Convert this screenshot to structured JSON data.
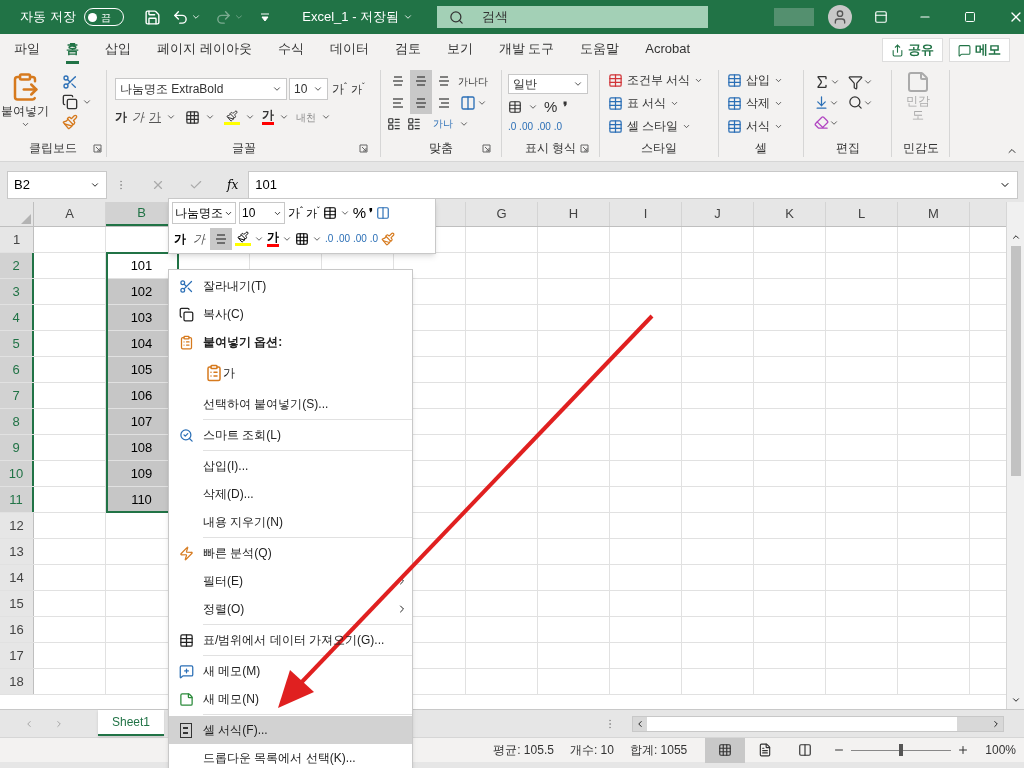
{
  "title_bar": {
    "autosave_label": "자동 저장",
    "autosave_state": "끔",
    "autosave_on": false,
    "file_title": "Excel_1 - 저장됨",
    "search_placeholder": "검색"
  },
  "ribbon_tabs": [
    {
      "label": "파일",
      "selected": false
    },
    {
      "label": "홈",
      "selected": true
    },
    {
      "label": "삽입",
      "selected": false
    },
    {
      "label": "페이지 레이아웃",
      "selected": false
    },
    {
      "label": "수식",
      "selected": false
    },
    {
      "label": "데이터",
      "selected": false
    },
    {
      "label": "검토",
      "selected": false
    },
    {
      "label": "보기",
      "selected": false
    },
    {
      "label": "개발 도구",
      "selected": false
    },
    {
      "label": "도움말",
      "selected": false
    },
    {
      "label": "Acrobat",
      "selected": false
    }
  ],
  "share_button": "공유",
  "comments_button": "메모",
  "ribbon": {
    "clipboard": {
      "paste": "붙여넣기",
      "label": "클립보드"
    },
    "font": {
      "name": "나눔명조 ExtraBold",
      "size": "10",
      "grow": "가$^{ˆ}$",
      "shrink": "가$^{ˇ}$",
      "bold": "가",
      "italic": "가",
      "underline": "가",
      "font_color": "가",
      "phonetic": "내천",
      "label": "글꼴"
    },
    "alignment": {
      "vertical": [
        {
          "selected": false
        },
        {
          "selected": true
        },
        {
          "selected": false
        }
      ],
      "horizontal": [
        {
          "selected": false
        },
        {
          "selected": true
        },
        {
          "selected": false
        }
      ],
      "wrap": "가나다",
      "orientation": "가나",
      "label": "맞춤"
    },
    "number": {
      "format": "일반",
      "percent": "%",
      "comma": "❜",
      "inc_decimal": ".0 .00",
      "dec_decimal": ".00 .0",
      "label": "표시 형식"
    },
    "styles": {
      "items": [
        "조건부 서식",
        "표 서식",
        "셀 스타일"
      ],
      "label": "스타일"
    },
    "cells": {
      "items": [
        "삽입",
        "삭제",
        "서식"
      ],
      "label": "셀"
    },
    "editing": {
      "label": "편집"
    },
    "sensitivity": {
      "button": "민감도",
      "label": "민감도",
      "disabled": true
    }
  },
  "formula_bar": {
    "name_box": "B2",
    "fx": "fx",
    "value": "101"
  },
  "columns_left": [
    {
      "label": "A",
      "selected": false
    },
    {
      "label": "B",
      "selected": true
    }
  ],
  "columns_right": [
    {
      "label": "G",
      "selected": false
    },
    {
      "label": "H",
      "selected": false
    },
    {
      "label": "I",
      "selected": false
    },
    {
      "label": "J",
      "selected": false
    },
    {
      "label": "K",
      "selected": false
    },
    {
      "label": "L",
      "selected": false
    },
    {
      "label": "M",
      "selected": false
    }
  ],
  "rows": [
    {
      "label": "1",
      "selected": false
    },
    {
      "label": "2",
      "selected": true,
      "cell_b": {
        "value": "101",
        "active": true
      }
    },
    {
      "label": "3",
      "selected": true,
      "cell_b": {
        "value": "102",
        "active": false
      }
    },
    {
      "label": "4",
      "selected": true,
      "cell_b": {
        "value": "103",
        "active": false
      }
    },
    {
      "label": "5",
      "selected": true,
      "cell_b": {
        "value": "104",
        "active": false
      }
    },
    {
      "label": "6",
      "selected": true,
      "cell_b": {
        "value": "105",
        "active": false
      }
    },
    {
      "label": "7",
      "selected": true,
      "cell_b": {
        "value": "106",
        "active": false
      }
    },
    {
      "label": "8",
      "selected": true,
      "cell_b": {
        "value": "107",
        "active": false
      }
    },
    {
      "label": "9",
      "selected": true,
      "cell_b": {
        "value": "108",
        "active": false
      }
    },
    {
      "label": "10",
      "selected": true,
      "cell_b": {
        "value": "109",
        "active": false
      }
    },
    {
      "label": "11",
      "selected": true,
      "cell_b": {
        "value": "110",
        "active": false
      }
    },
    {
      "label": "12",
      "selected": false
    },
    {
      "label": "13",
      "selected": false
    },
    {
      "label": "14",
      "selected": false
    },
    {
      "label": "15",
      "selected": false
    },
    {
      "label": "16",
      "selected": false
    },
    {
      "label": "17",
      "selected": false
    },
    {
      "label": "18",
      "selected": false
    }
  ],
  "mini_toolbar": {
    "font": "나눔명조",
    "size": "10",
    "grow": "가$^{ˆ}$",
    "shrink": "가$^{ˇ}$",
    "percent": "%",
    "comma": "❜",
    "bold": "가",
    "italic": "가",
    "center_selected": true,
    "font_color": "가",
    "inc_decimal": ".0 .00",
    "dec_decimal": ".00 .0"
  },
  "context_menu": [
    {
      "kind": "item",
      "label": "잘라내기(T)",
      "selected": false
    },
    {
      "kind": "item",
      "label": "복사(C)",
      "selected": false
    },
    {
      "kind": "header",
      "label": "붙여넣기 옵션:"
    },
    {
      "kind": "paste_option",
      "label": "가"
    },
    {
      "kind": "item",
      "label": "선택하여 붙여넣기(S)...",
      "selected": false
    },
    {
      "kind": "separator"
    },
    {
      "kind": "item",
      "label": "스마트 조회(L)",
      "selected": false
    },
    {
      "kind": "separator"
    },
    {
      "kind": "item",
      "label": "삽입(I)...",
      "selected": false
    },
    {
      "kind": "item",
      "label": "삭제(D)...",
      "selected": false
    },
    {
      "kind": "item",
      "label": "내용 지우기(N)",
      "selected": false
    },
    {
      "kind": "separator"
    },
    {
      "kind": "item",
      "label": "빠른 분석(Q)",
      "selected": false
    },
    {
      "kind": "submenu",
      "label": "필터(E)",
      "selected": false
    },
    {
      "kind": "submenu",
      "label": "정렬(O)",
      "selected": false
    },
    {
      "kind": "separator"
    },
    {
      "kind": "item",
      "label": "표/범위에서 데이터 가져오기(G)...",
      "selected": false
    },
    {
      "kind": "separator"
    },
    {
      "kind": "item",
      "label": "새 메모(M)",
      "selected": false
    },
    {
      "kind": "item",
      "label": "새 메모(N)",
      "selected": false
    },
    {
      "kind": "separator"
    },
    {
      "kind": "item",
      "label": "셀 서식(F)...",
      "selected": true
    },
    {
      "kind": "item",
      "label": "드롭다운 목록에서 선택(K)...",
      "selected": false
    }
  ],
  "sheet_tabs": [
    {
      "label": "Sheet1",
      "selected": true
    }
  ],
  "status_bar": {
    "average": "평균: 105.5",
    "count": "개수: 10",
    "sum": "합계: 1055",
    "views": [
      {
        "selected": true
      },
      {
        "selected": false
      },
      {
        "selected": false
      }
    ],
    "zoom": "100%",
    "zoom_level": {
      "level": 0.5
    }
  }
}
